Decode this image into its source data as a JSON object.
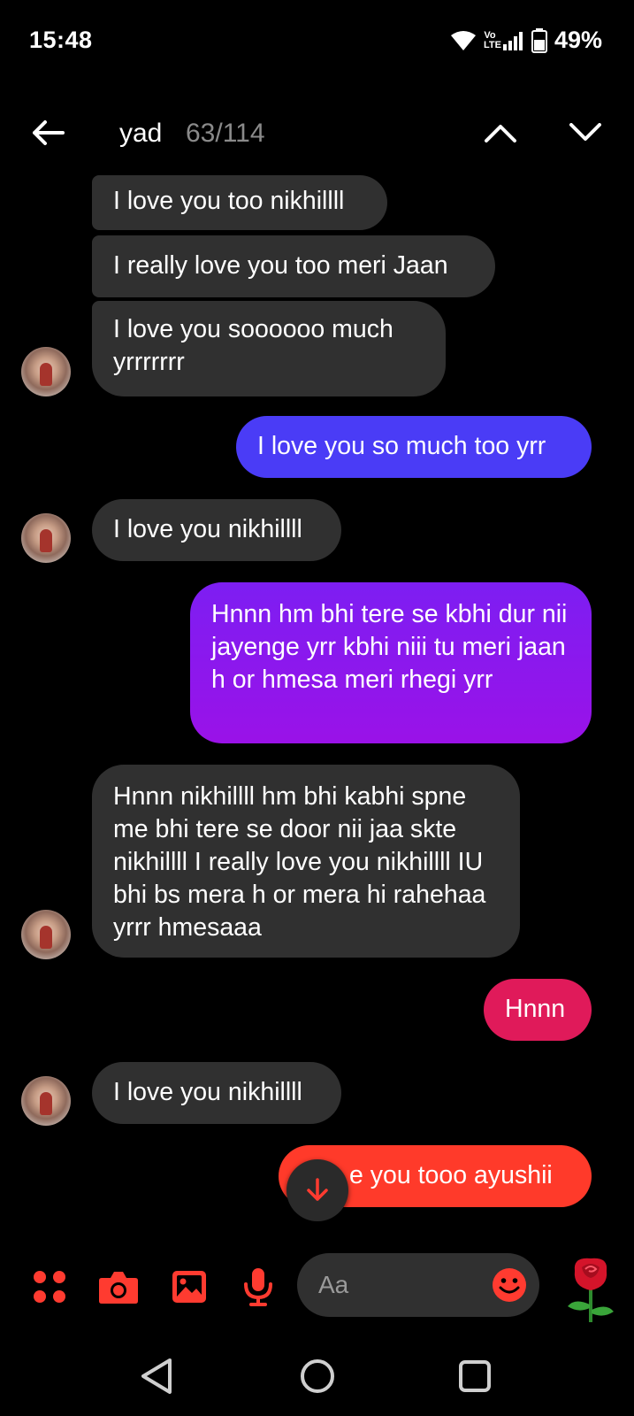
{
  "status_bar": {
    "time": "15:48",
    "volte": "Vo LTE",
    "battery": "49%"
  },
  "header": {
    "search_term": "yad",
    "search_count": "63/114",
    "icons": [
      "back-arrow-icon",
      "chevron-up-icon",
      "chevron-down-icon"
    ]
  },
  "messages": [
    {
      "direction": "incoming",
      "text": "I love you too nikhillll"
    },
    {
      "direction": "incoming",
      "text": "I really love you too meri Jaan"
    },
    {
      "direction": "incoming",
      "text": "I love you soooooo much yrrrrrrr"
    },
    {
      "direction": "outgoing",
      "text": "I love you so much too yrr"
    },
    {
      "direction": "incoming",
      "text": "I love you nikhillll"
    },
    {
      "direction": "outgoing",
      "text": "Hnnn hm bhi tere se kbhi dur nii jayenge yrr kbhi niii tu meri jaan h or hmesa meri rhegi yrr"
    },
    {
      "direction": "incoming",
      "text": "Hnnn nikhillll hm bhi kabhi spne me bhi tere se door nii jaa skte nikhillll I really love you nikhillll IU bhi bs mera h or mera hi rahehaa yrrr hmesaaa"
    },
    {
      "direction": "outgoing",
      "text": "Hnnn"
    },
    {
      "direction": "incoming",
      "text": "I love you nikhillll"
    },
    {
      "direction": "outgoing",
      "text": "e you tooo ayushii"
    }
  ],
  "composer": {
    "placeholder": "Aa",
    "icons": [
      "apps-grid-icon",
      "camera-icon",
      "gallery-icon",
      "microphone-icon",
      "emoji-icon",
      "rose-icon"
    ]
  },
  "colors": {
    "background": "#000000",
    "incoming_bubble": "#303030",
    "outgoing_blue": "#4a3cf6",
    "outgoing_purple": "#8a1bf0",
    "outgoing_pink": "#e01a5a",
    "outgoing_red": "#ff3a2a",
    "accent": "#ff3b30"
  }
}
